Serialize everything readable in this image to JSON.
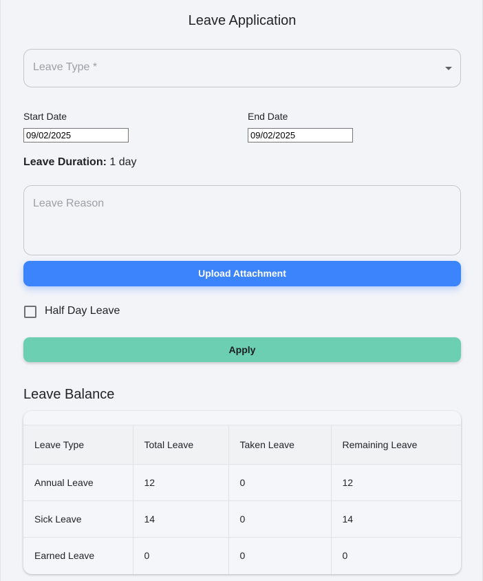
{
  "form": {
    "title": "Leave Application",
    "leave_type_placeholder": "Leave Type *",
    "start_date_label": "Start Date",
    "start_date_value": "09/02/2025",
    "end_date_label": "End Date",
    "end_date_value": "09/02/2025",
    "duration_label": "Leave Duration:",
    "duration_value": "1 day",
    "reason_placeholder": "Leave Reason",
    "upload_label": "Upload Attachment",
    "half_day_label": "Half Day Leave",
    "half_day_checked": false,
    "apply_label": "Apply"
  },
  "balance": {
    "title": "Leave Balance",
    "columns": [
      "Leave Type",
      "Total Leave",
      "Taken Leave",
      "Remaining Leave"
    ],
    "rows": [
      [
        "Annual Leave",
        "12",
        "0",
        "12"
      ],
      [
        "Sick Leave",
        "14",
        "0",
        "14"
      ],
      [
        "Earned Leave",
        "0",
        "0",
        "0"
      ]
    ]
  },
  "colors": {
    "upload_button": "#3b84fb",
    "apply_button": "#6ccfb1",
    "background": "#f3f4f8"
  }
}
